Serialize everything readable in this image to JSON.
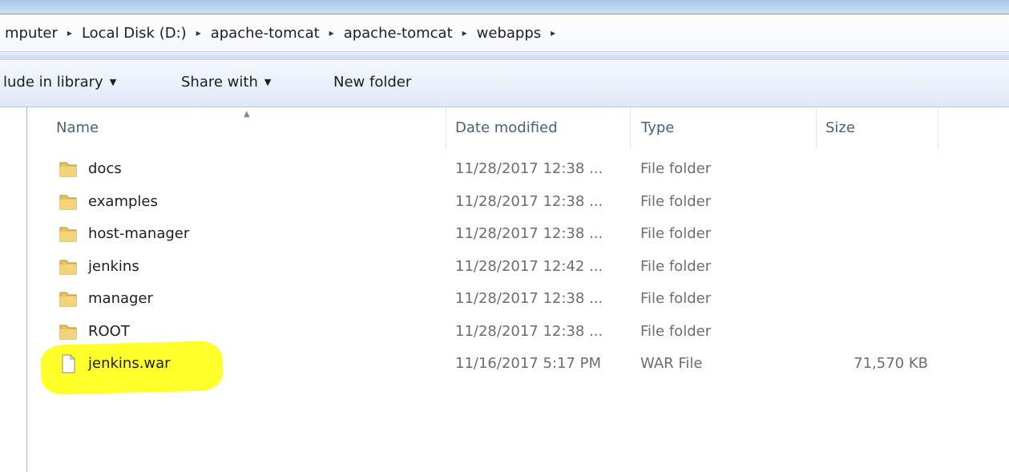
{
  "address_bar": {
    "breadcrumbs": [
      "mputer",
      "Local Disk (D:)",
      "apache-tomcat",
      "apache-tomcat",
      "webapps"
    ],
    "trailing_separator": "▸"
  },
  "toolbar": {
    "include_in_library": "lude in library",
    "share_with": "Share with",
    "new_folder": "New folder",
    "dropdown_arrow": "▼"
  },
  "columns": {
    "name": "Name",
    "date_modified": "Date modified",
    "type": "Type",
    "size": "Size",
    "sort_indicator": "▲"
  },
  "files": [
    {
      "name": "docs",
      "date": "11/28/2017 12:38 ...",
      "type": "File folder",
      "size": "",
      "icon": "folder-icon"
    },
    {
      "name": "examples",
      "date": "11/28/2017 12:38 ...",
      "type": "File folder",
      "size": "",
      "icon": "folder-icon"
    },
    {
      "name": "host-manager",
      "date": "11/28/2017 12:38 ...",
      "type": "File folder",
      "size": "",
      "icon": "folder-icon"
    },
    {
      "name": "jenkins",
      "date": "11/28/2017 12:42 ...",
      "type": "File folder",
      "size": "",
      "icon": "folder-icon"
    },
    {
      "name": "manager",
      "date": "11/28/2017 12:38 ...",
      "type": "File folder",
      "size": "",
      "icon": "folder-icon"
    },
    {
      "name": "ROOT",
      "date": "11/28/2017 12:38 ...",
      "type": "File folder",
      "size": "",
      "icon": "folder-icon"
    },
    {
      "name": "jenkins.war",
      "date": "11/16/2017 5:17 PM",
      "type": "WAR File",
      "size": "71,570 KB",
      "icon": "file-icon"
    }
  ],
  "colors": {
    "highlight": "#ffff2a",
    "header_text": "#4c607a",
    "folder_yellow": "#e9c25a"
  }
}
